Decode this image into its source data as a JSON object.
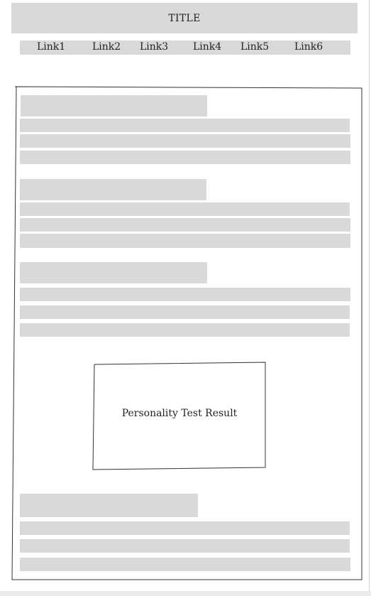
{
  "header": {
    "title": "TITLE"
  },
  "nav": {
    "links": [
      "Link1",
      "Link2",
      "Link3",
      "Link4",
      "Link5",
      "Link6"
    ]
  },
  "result_box": {
    "label": "Personality Test Result"
  },
  "colors": {
    "placeholder_fill": "#d9d9d9",
    "stroke": "#333333",
    "background": "#ffffff"
  }
}
